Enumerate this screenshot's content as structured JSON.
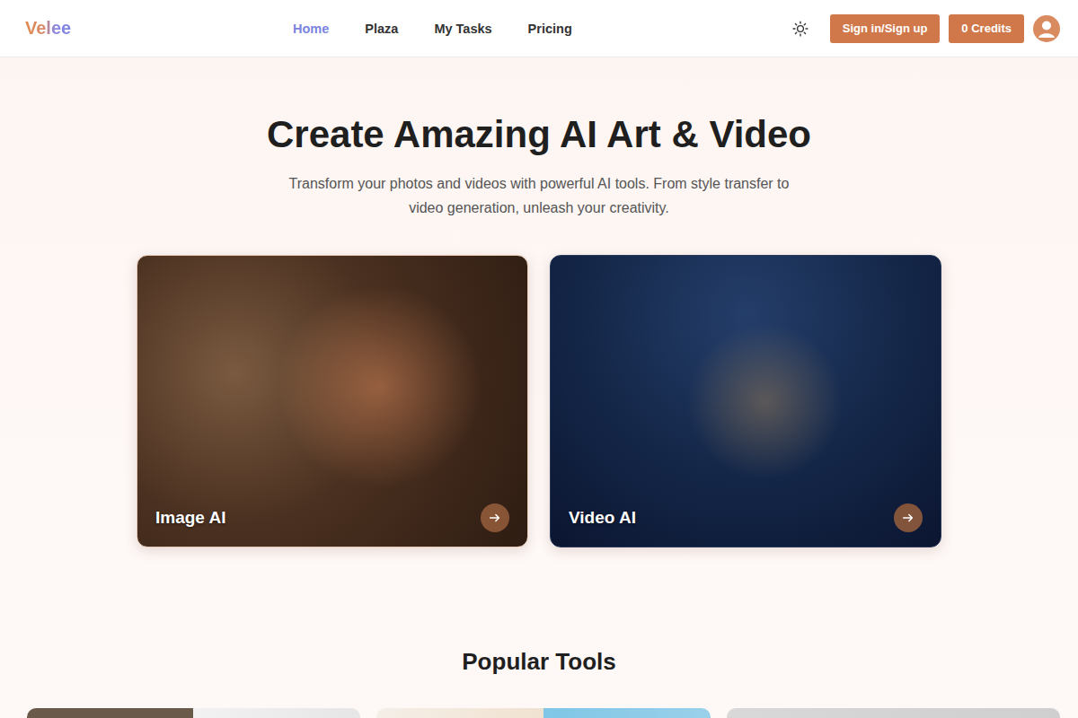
{
  "logo": "Velee",
  "nav": [
    {
      "label": "Home",
      "selected": true
    },
    {
      "label": "Plaza",
      "selected": false
    },
    {
      "label": "My Tasks",
      "selected": false
    },
    {
      "label": "Pricing",
      "selected": false
    }
  ],
  "actions": {
    "sign_in": "Sign in/Sign up",
    "credits": "0 Credits"
  },
  "hero": {
    "title": "Create Amazing AI Art & Video",
    "subtitle": "Transform your photos and videos with powerful AI tools. From style transfer to video generation, unleash your creativity."
  },
  "features": [
    {
      "label": "Image AI",
      "kind": "image"
    },
    {
      "label": "Video AI",
      "kind": "video"
    }
  ],
  "popular_tools": {
    "title": "Popular Tools"
  }
}
